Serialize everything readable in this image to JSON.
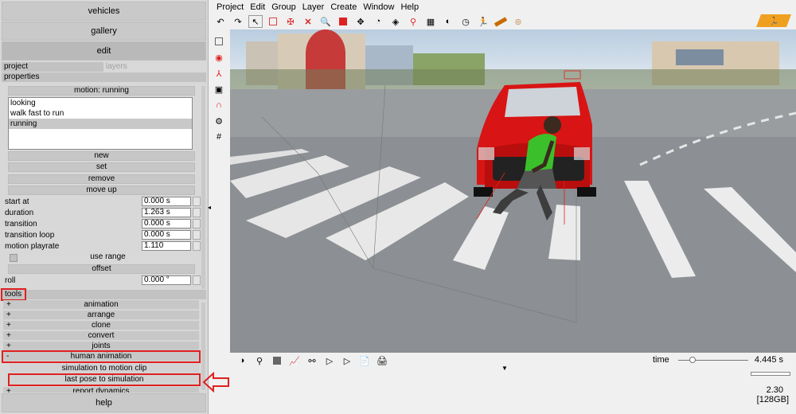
{
  "left_panel": {
    "vehicles": "vehicles",
    "gallery": "gallery",
    "edit": "edit",
    "tab_project": "project",
    "tab_layers": "layers",
    "properties": "properties",
    "motion_label": "motion: running",
    "motions": [
      "looking",
      "walk fast to run",
      "running"
    ],
    "buttons": {
      "new": "new",
      "set": "set",
      "remove": "remove",
      "move_up": "move up"
    },
    "fields": [
      {
        "label": "start at",
        "value": "0.000 s"
      },
      {
        "label": "duration",
        "value": "1.263 s"
      },
      {
        "label": "transition",
        "value": "0.000 s"
      },
      {
        "label": "transition loop",
        "value": "0.000 s"
      },
      {
        "label": "motion playrate",
        "value": "1.110"
      }
    ],
    "use_range": "use range",
    "offset": "offset",
    "roll_label": "roll",
    "roll_value": "0.000 °",
    "tools": "tools",
    "tool_items": [
      {
        "pm": "+",
        "label": "animation"
      },
      {
        "pm": "+",
        "label": "arrange"
      },
      {
        "pm": "+",
        "label": "clone"
      },
      {
        "pm": "+",
        "label": "convert"
      },
      {
        "pm": "+",
        "label": "joints"
      },
      {
        "pm": "-",
        "label": "human animation"
      }
    ],
    "sub_items": [
      "simulation to motion clip",
      "last pose to simulation"
    ],
    "report_dynamics": {
      "pm": "+",
      "label": "report dynamics"
    },
    "help": "help"
  },
  "menu": [
    "Project",
    "Edit",
    "Group",
    "Layer",
    "Create",
    "Window",
    "Help"
  ],
  "status": {
    "time_label": "time",
    "time_value": "4.445 s",
    "time_position": 0.2,
    "version": "2.30",
    "memory": "[128GB]"
  },
  "colors": {
    "accent_red": "#e02020",
    "car_red": "#d81414",
    "shirt_green": "#3bbf2a"
  }
}
